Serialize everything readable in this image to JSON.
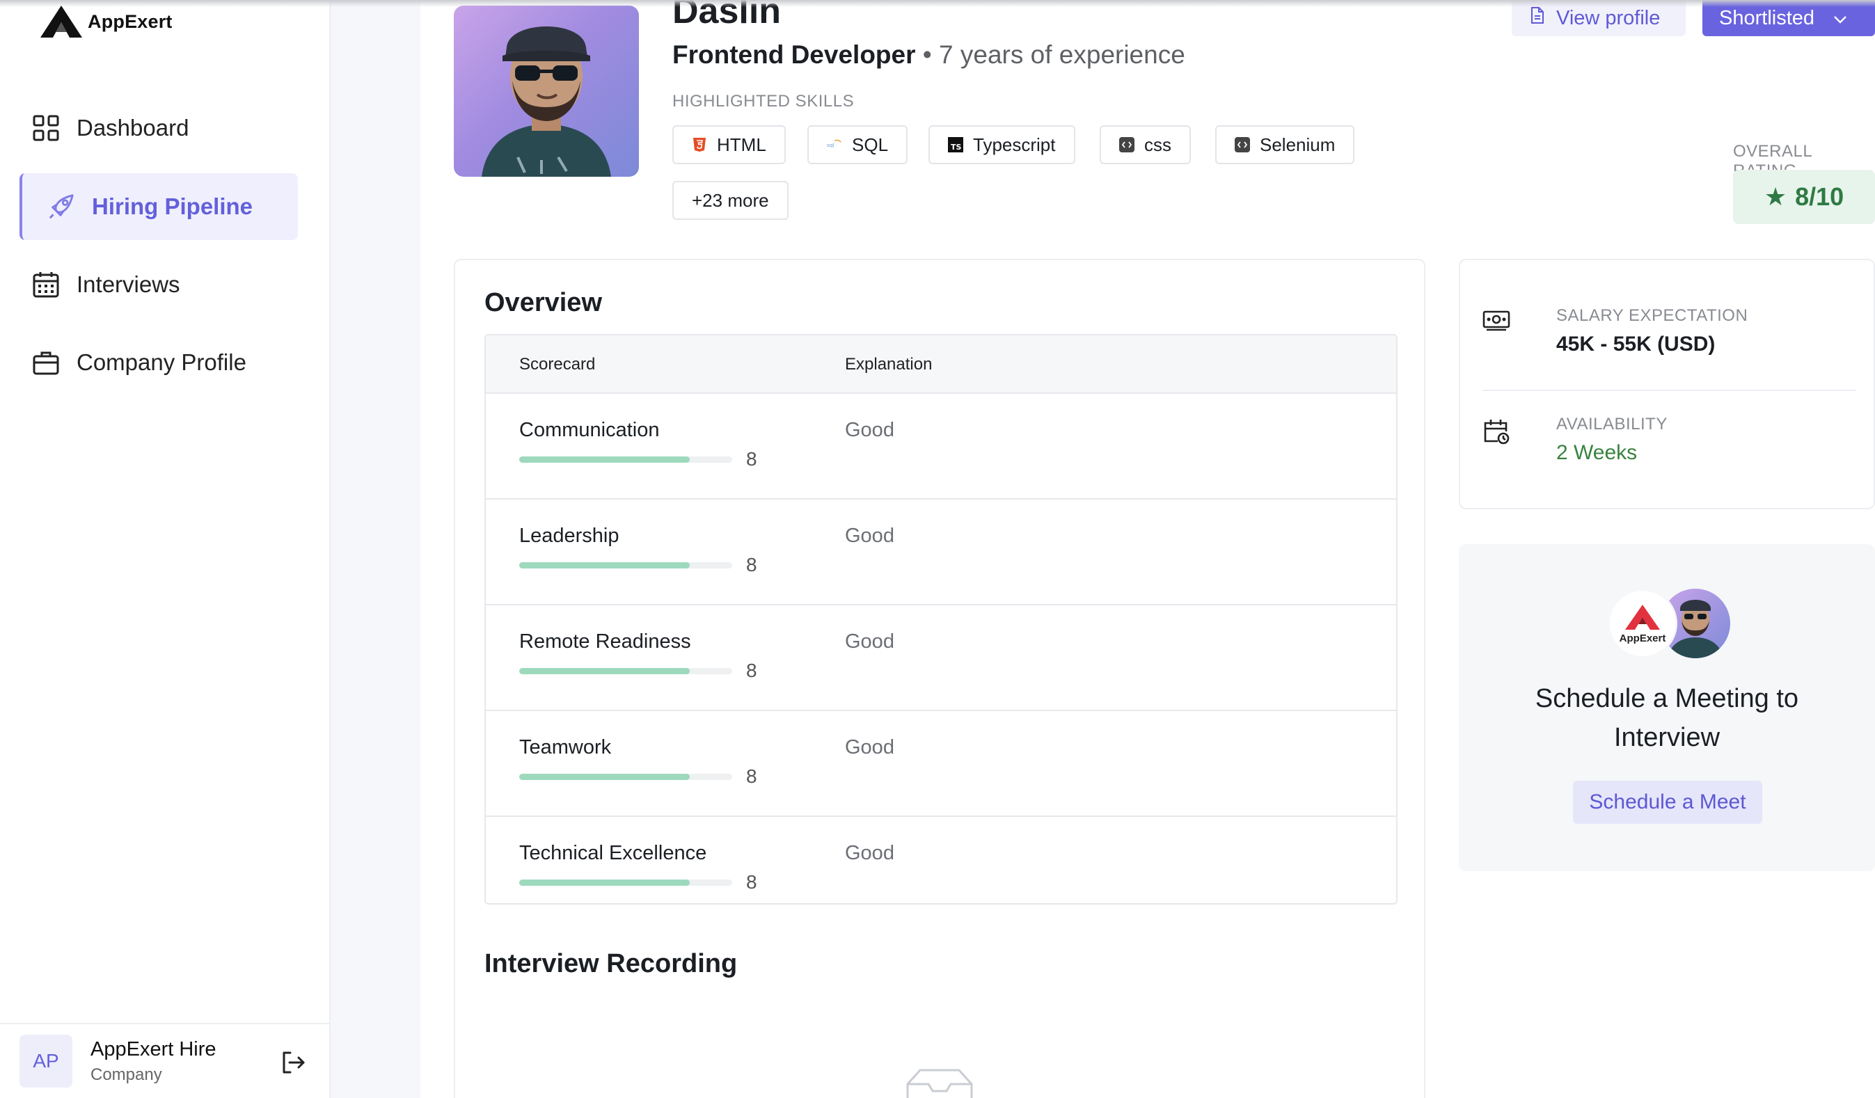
{
  "app": {
    "brand": "AppExert"
  },
  "sidebar": {
    "items": [
      {
        "label": "Dashboard",
        "icon": "grid-icon",
        "active": false
      },
      {
        "label": "Hiring Pipeline",
        "icon": "rocket-icon",
        "active": true
      },
      {
        "label": "Interviews",
        "icon": "calendar-icon",
        "active": false
      },
      {
        "label": "Company Profile",
        "icon": "briefcase-icon",
        "active": false
      }
    ],
    "user": {
      "initials": "AP",
      "name": "AppExert Hire",
      "role": "Company"
    }
  },
  "candidate": {
    "name": "Daslin",
    "title": "Frontend Developer",
    "separator": "•",
    "experience": "7 years of experience",
    "skills_label": "HIGHLIGHTED SKILLS",
    "skills": [
      {
        "label": "HTML",
        "icon": "html5-icon"
      },
      {
        "label": "SQL",
        "icon": "sql-icon"
      },
      {
        "label": "Typescript",
        "icon": "typescript-icon"
      },
      {
        "label": "css",
        "icon": "code-icon"
      },
      {
        "label": "Selenium",
        "icon": "code-icon"
      }
    ],
    "more_skills": "+23 more"
  },
  "actions": {
    "view_profile": "View profile",
    "status": "Shortlisted"
  },
  "rating": {
    "label": "OVERALL RATING",
    "value": "8/10",
    "star": "★"
  },
  "overview": {
    "title": "Overview",
    "columns": {
      "scorecard": "Scorecard",
      "explanation": "Explanation"
    },
    "rows": [
      {
        "name": "Communication",
        "score": 8,
        "max": 10,
        "explanation": "Good"
      },
      {
        "name": "Leadership",
        "score": 8,
        "max": 10,
        "explanation": "Good"
      },
      {
        "name": "Remote Readiness",
        "score": 8,
        "max": 10,
        "explanation": "Good"
      },
      {
        "name": "Teamwork",
        "score": 8,
        "max": 10,
        "explanation": "Good"
      },
      {
        "name": "Technical Excellence",
        "score": 8,
        "max": 10,
        "explanation": "Good"
      }
    ]
  },
  "recording": {
    "title": "Interview Recording"
  },
  "info": {
    "salary_label": "SALARY EXPECTATION",
    "salary_value": "45K - 55K (USD)",
    "availability_label": "AVAILABILITY",
    "availability_value": "2 Weeks",
    "availability_color": "#37833f"
  },
  "meet": {
    "logo_text": "AppExert",
    "title_line1": "Schedule a Meeting to",
    "title_line2": "Interview",
    "button": "Schedule a Meet"
  },
  "colors": {
    "accent": "#6963e0",
    "rating_green": "#2f7a44",
    "score_bar": "#9ed9bd"
  }
}
